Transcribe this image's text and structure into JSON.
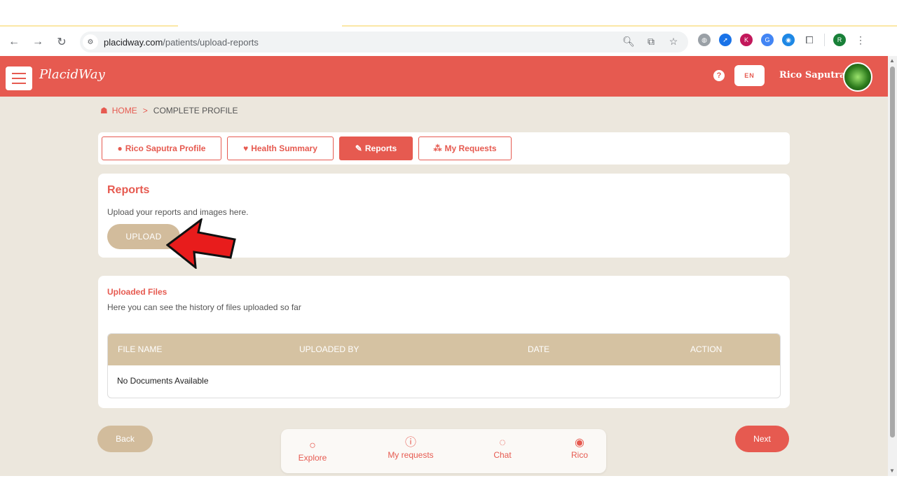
{
  "browser": {
    "url_host": "placidway.com",
    "url_path": "/patients/upload-reports",
    "profile_initial": "R"
  },
  "app": {
    "logo_text": "PlacidWay",
    "help_label": "?",
    "lang_label": "EN",
    "user_name": "Rico Saputra"
  },
  "breadcrumb": {
    "home": "HOME",
    "separator": ">",
    "current": "COMPLETE PROFILE"
  },
  "profile_tabs": [
    {
      "label": "Rico Saputra Profile",
      "icon": "user-circle-icon",
      "active": false
    },
    {
      "label": "Health Summary",
      "icon": "heartbeat-icon",
      "active": false
    },
    {
      "label": "Reports",
      "icon": "file-edit-icon",
      "active": true
    },
    {
      "label": "My Requests",
      "icon": "requests-icon",
      "active": false
    }
  ],
  "reports": {
    "title": "Reports",
    "description": "Upload your reports and images here.",
    "upload_label": "UPLOAD"
  },
  "uploaded_files": {
    "title": "Uploaded Files",
    "description": "Here you can see the history of files uploaded so far",
    "columns": [
      "FILE NAME",
      "UPLOADED BY",
      "DATE",
      "ACTION"
    ],
    "empty_text": "No Documents Available"
  },
  "actions": {
    "back_label": "Back",
    "next_label": "Next"
  },
  "bottom_nav": [
    {
      "label": "Explore",
      "icon": "search-icon"
    },
    {
      "label": "My requests",
      "icon": "info-icon"
    },
    {
      "label": "Chat",
      "icon": "chat-icon"
    },
    {
      "label": "Rico",
      "icon": "user-icon"
    }
  ],
  "colors": {
    "brand": "#e65a50",
    "beige": "#d2bc9c",
    "background": "#ece7dd"
  }
}
